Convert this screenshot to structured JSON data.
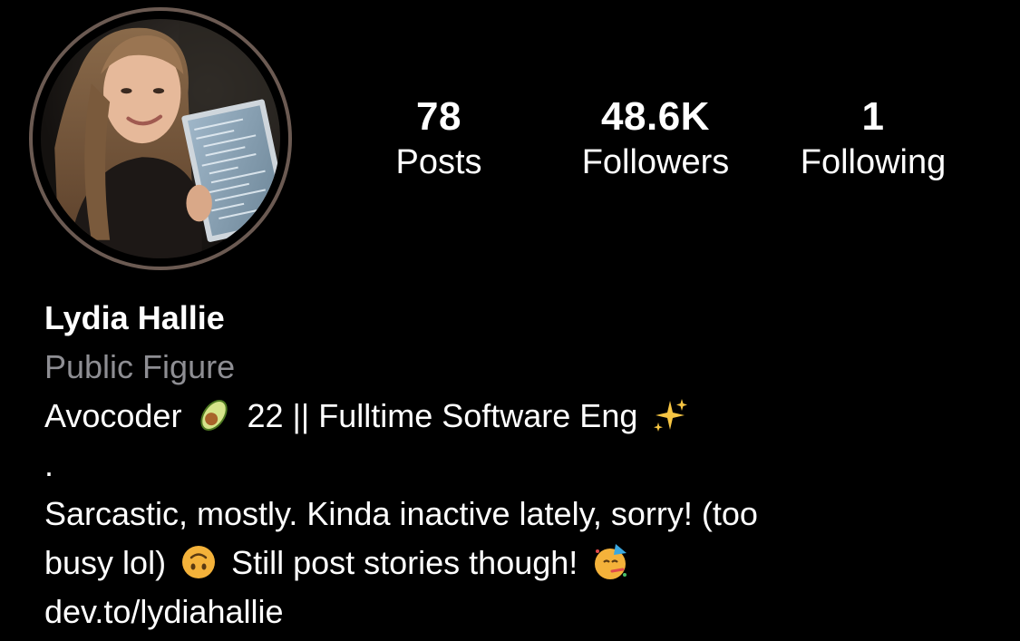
{
  "profile": {
    "avatar_icon": "profile-photo",
    "ring_color": "#6b5a52",
    "name": "Lydia Hallie",
    "category": "Public Figure"
  },
  "stats": {
    "posts": {
      "value": "78",
      "label": "Posts"
    },
    "followers": {
      "value": "48.6K",
      "label": "Followers"
    },
    "following": {
      "value": "1",
      "label": "Following"
    }
  },
  "bio": {
    "line1_a": "Avocoder",
    "line1_emoji1": "avocado-icon",
    "line1_b": "22 || Fulltime Software Eng",
    "line1_emoji2": "sparkles-icon",
    "line2": ".",
    "line3": "Sarcastic, mostly. Kinda inactive lately, sorry! (too",
    "line4_a": "busy lol)",
    "line4_emoji1": "upside-down-face-icon",
    "line4_b": "Still post stories though!",
    "line4_emoji2": "partying-face-icon",
    "link": "dev.to/lydiahallie"
  },
  "colors": {
    "background": "#000000",
    "text": "#ffffff",
    "secondary_text": "#8e8e93"
  }
}
